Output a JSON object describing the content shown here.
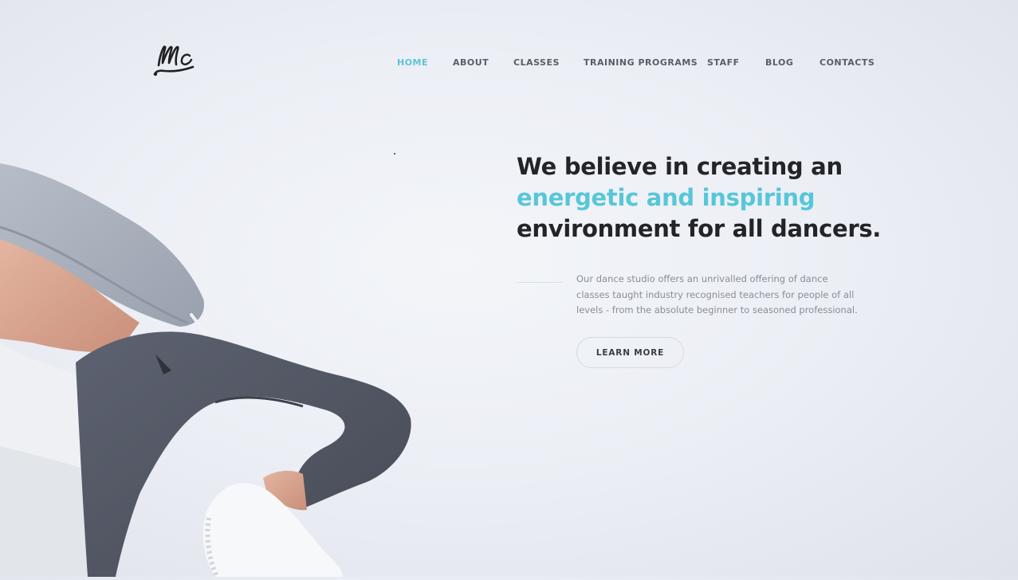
{
  "brand": {
    "logo_text": "Mc",
    "logo_color": "#1f2024"
  },
  "nav": {
    "items": [
      {
        "label": "HOME",
        "active": true
      },
      {
        "label": "ABOUT",
        "active": false
      },
      {
        "label": "CLASSES",
        "active": false
      },
      {
        "label": "TRAINING PROGRAMS",
        "active": false
      },
      {
        "label": "STAFF",
        "active": false
      },
      {
        "label": "BLOG",
        "active": false
      },
      {
        "label": "CONTACTS",
        "active": false
      }
    ],
    "active_color": "#5bc4d7",
    "text_color": "#5a5d66"
  },
  "hero": {
    "headline_line1": "We believe in creating an",
    "headline_accent": "energetic and inspiring",
    "headline_line3": "environment for all dancers.",
    "accent_color": "#58c6d9",
    "description_lines": [
      "Our dance studio offers an unrivalled offering of dance",
      "classes taught industry recognised teachers for people of all",
      "levels - from the absolute beginner to seasoned professional."
    ],
    "cta_label": "LEARN MORE",
    "photo_subject": "dancer-photo"
  }
}
